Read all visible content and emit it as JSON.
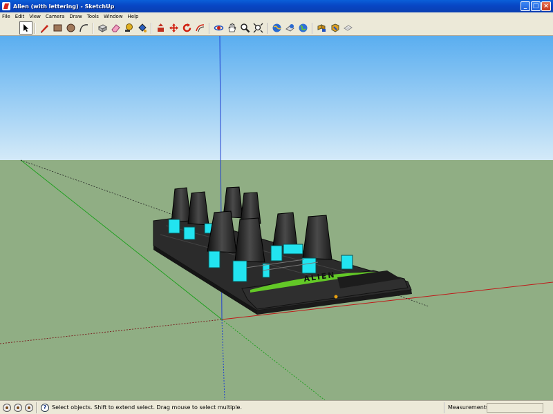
{
  "window": {
    "title": "Alien (with lettering) - SketchUp",
    "minimize": "_",
    "maximize": "□",
    "close": "×"
  },
  "menu": [
    "File",
    "Edit",
    "View",
    "Camera",
    "Draw",
    "Tools",
    "Window",
    "Help"
  ],
  "toolbar": {
    "tools": [
      {
        "name": "select-tool",
        "icon": "arrow-icon",
        "active": true
      },
      {
        "name": "line-tool",
        "icon": "pencil-icon"
      },
      {
        "name": "rectangle-tool",
        "icon": "rectangle-icon"
      },
      {
        "name": "circle-tool",
        "icon": "circle-icon"
      },
      {
        "name": "arc-tool",
        "icon": "arc-icon"
      },
      {
        "name": "make-component-tool",
        "icon": "component-icon"
      },
      {
        "name": "eraser-tool",
        "icon": "eraser-icon"
      },
      {
        "name": "tape-measure-tool",
        "icon": "tape-measure-icon"
      },
      {
        "name": "paint-bucket-tool",
        "icon": "paint-bucket-icon"
      },
      {
        "name": "push-pull-tool",
        "icon": "push-pull-icon"
      },
      {
        "name": "move-tool",
        "icon": "move-icon"
      },
      {
        "name": "rotate-tool",
        "icon": "rotate-icon"
      },
      {
        "name": "offset-tool",
        "icon": "offset-icon"
      },
      {
        "name": "orbit-tool",
        "icon": "orbit-icon"
      },
      {
        "name": "pan-tool",
        "icon": "hand-icon"
      },
      {
        "name": "zoom-tool",
        "icon": "magnifier-icon"
      },
      {
        "name": "zoom-extents-tool",
        "icon": "zoom-extents-icon"
      },
      {
        "name": "get-models-tool",
        "icon": "globe-icon"
      },
      {
        "name": "share-model-tool",
        "icon": "share-icon"
      },
      {
        "name": "google-earth-tool",
        "icon": "earth-icon"
      },
      {
        "name": "components-tool",
        "icon": "boxes-icon"
      },
      {
        "name": "extension-tool",
        "icon": "puzzle-icon"
      },
      {
        "name": "styles-tool",
        "icon": "styles-icon"
      }
    ]
  },
  "scene": {
    "sky_top": "#5aaef0",
    "sky_bottom": "#d4eaf8",
    "ground": "#90ae84",
    "ride_color": "#2b2b2b",
    "seat_panel_color": "#22e4f0",
    "nose_color": "#63c827",
    "lettering": "ALIEN"
  },
  "status": {
    "message": "Select objects. Shift to extend select. Drag mouse to select multiple.",
    "measurements_label": "Measurements",
    "measurements_value": ""
  }
}
